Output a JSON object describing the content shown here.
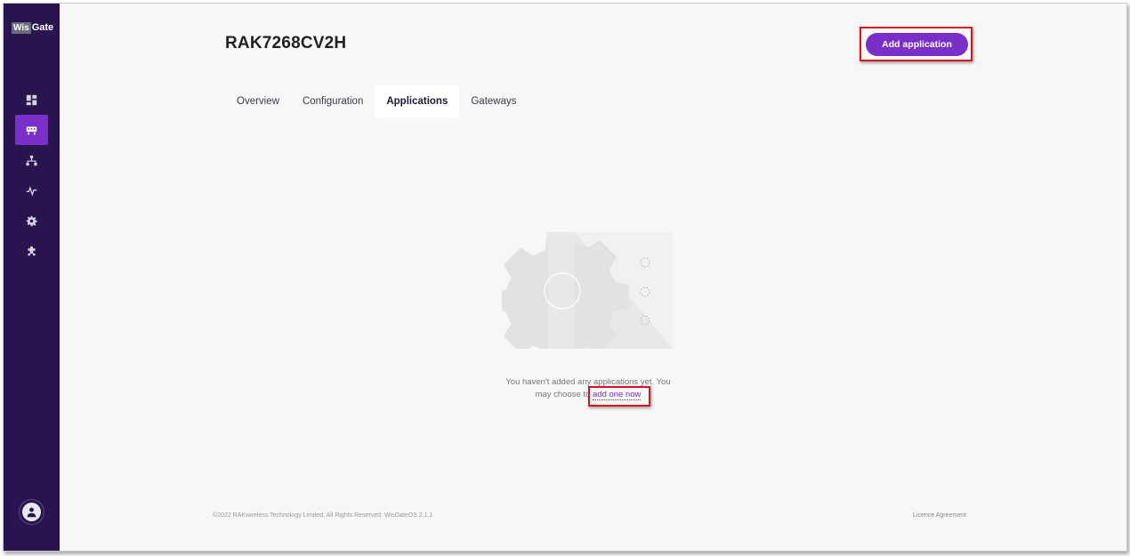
{
  "brand": {
    "logo_part1": "Wis",
    "logo_part2": "Gate"
  },
  "sidebar": {
    "items": [
      {
        "name": "dashboard",
        "icon": "dashboard-icon",
        "active": false
      },
      {
        "name": "devices",
        "icon": "device-icon",
        "active": true
      },
      {
        "name": "network",
        "icon": "network-icon",
        "active": false
      },
      {
        "name": "activity",
        "icon": "activity-icon",
        "active": false
      },
      {
        "name": "settings",
        "icon": "gear-icon",
        "active": false
      },
      {
        "name": "extensions",
        "icon": "puzzle-icon",
        "active": false
      }
    ],
    "user_icon": "user-icon"
  },
  "header": {
    "device_name": "RAK7268CV2H",
    "add_button_label": "Add application"
  },
  "tabs": [
    {
      "label": "Overview",
      "active": false
    },
    {
      "label": "Configuration",
      "active": false
    },
    {
      "label": "Applications",
      "active": true
    },
    {
      "label": "Gateways",
      "active": false
    }
  ],
  "empty_state": {
    "message_part1": "You haven't added any applications yet. You may choose to",
    "link_label": "add one now",
    "illustration": "gear-illustration"
  },
  "footer": {
    "copyright": "©2022 RAKwireless Technology Limited. All Rights Reserved. WisGateOS 2.1.1",
    "licence_label": "Licence Agreement"
  },
  "colors": {
    "sidebar_bg": "#2a1450",
    "accent": "#7b2fc9",
    "highlight": "#d9141c"
  }
}
